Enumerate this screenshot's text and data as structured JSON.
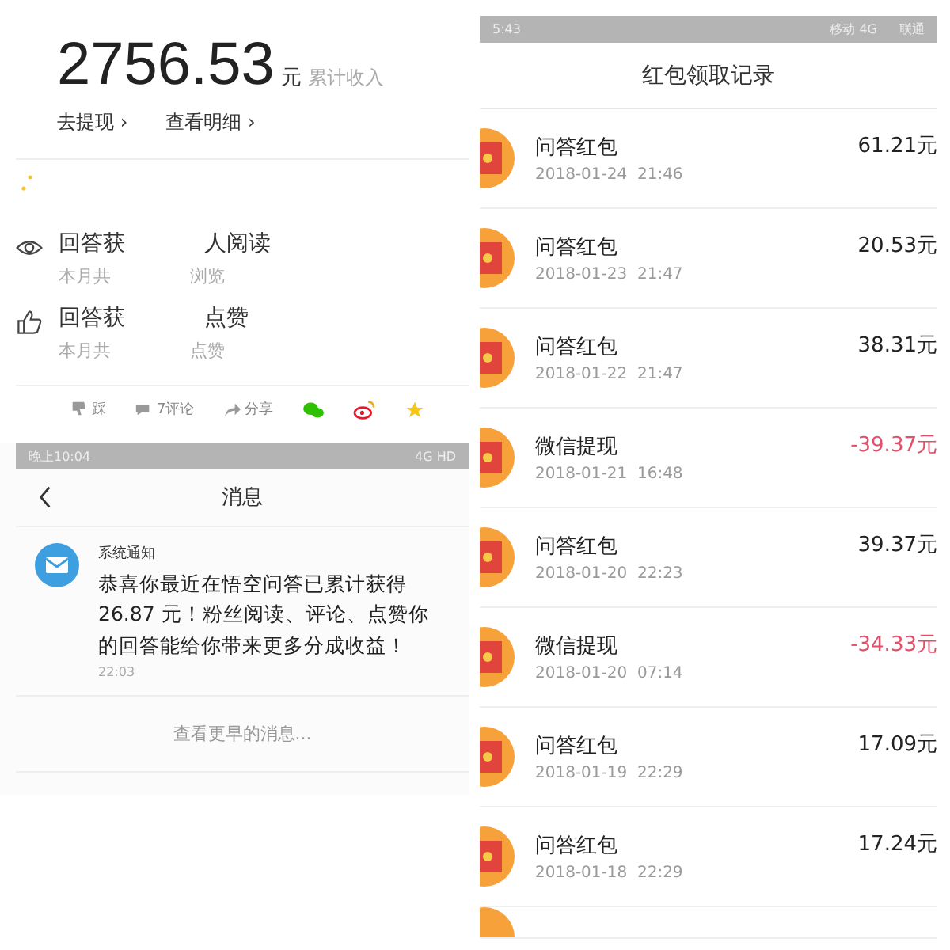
{
  "earnings": {
    "amount": "2756.53",
    "unit": "元",
    "caption": "累计收入",
    "links": [
      "去提现 ›",
      "查看明细 ›"
    ]
  },
  "stats": [
    {
      "kind": "eye",
      "title_parts": [
        "回答获",
        "人阅读"
      ],
      "sub_parts": [
        "本月共",
        "浏览"
      ]
    },
    {
      "kind": "thumb",
      "title_parts": [
        "回答获",
        "点赞"
      ],
      "sub_parts": [
        "本月共",
        "点赞"
      ]
    }
  ],
  "actions": [
    {
      "kind": "dislike",
      "label": "踩"
    },
    {
      "kind": "comment",
      "label": "7评论"
    },
    {
      "kind": "share",
      "label": "分享"
    },
    {
      "kind": "wechat"
    },
    {
      "kind": "weibo"
    },
    {
      "kind": "star"
    }
  ],
  "messages": {
    "status_bar": {
      "time": "晚上10:04",
      "network": "4G HD"
    },
    "title": "消息",
    "items": [
      {
        "sender": "系统通知",
        "text": "恭喜你最近在悟空问答已累计获得26.87 元！粉丝阅读、评论、点赞你的回答能给你带来更多分成收益！",
        "time": "22:03"
      }
    ],
    "more": "查看更早的消息..."
  },
  "records": {
    "status_bar": {
      "time": "5:43",
      "carrier_1": "移动 4G",
      "carrier_2": "联通"
    },
    "title": "红包领取记录",
    "rows": [
      {
        "name": "问答红包",
        "date": "2018-01-24  21:46",
        "amount": "61.21元",
        "negative": false
      },
      {
        "name": "问答红包",
        "date": "2018-01-23  21:47",
        "amount": "20.53元",
        "negative": false
      },
      {
        "name": "问答红包",
        "date": "2018-01-22  21:47",
        "amount": "38.31元",
        "negative": false
      },
      {
        "name": "微信提现",
        "date": "2018-01-21  16:48",
        "amount": "-39.37元",
        "negative": true
      },
      {
        "name": "问答红包",
        "date": "2018-01-20  22:23",
        "amount": "39.37元",
        "negative": false
      },
      {
        "name": "微信提现",
        "date": "2018-01-20  07:14",
        "amount": "-34.33元",
        "negative": true
      },
      {
        "name": "问答红包",
        "date": "2018-01-19  22:29",
        "amount": "17.09元",
        "negative": false
      },
      {
        "name": "问答红包",
        "date": "2018-01-18  22:29",
        "amount": "17.24元",
        "negative": false
      }
    ]
  }
}
